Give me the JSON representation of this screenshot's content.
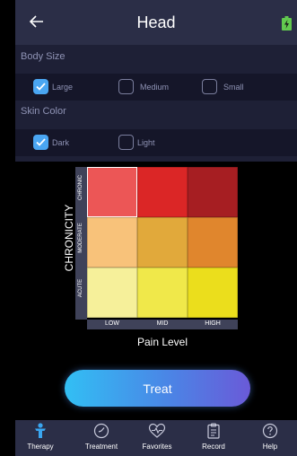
{
  "header": {
    "title": "Head",
    "back_icon": "arrow-left-icon",
    "battery_icon": "battery-icon"
  },
  "body_size": {
    "label": "Body Size",
    "options": [
      {
        "label": "Large",
        "checked": true
      },
      {
        "label": "Medium",
        "checked": false
      },
      {
        "label": "Small",
        "checked": false
      }
    ]
  },
  "skin_color": {
    "label": "Skin Color",
    "options": [
      {
        "label": "Dark",
        "checked": true
      },
      {
        "label": "Light",
        "checked": false
      }
    ]
  },
  "matrix": {
    "y_axis_title": "CHRONICITY",
    "x_axis_title": "Pain Level",
    "rows": [
      "CHRONIC",
      "MODERATE",
      "ACUTE"
    ],
    "cols": [
      "LOW",
      "MID",
      "HIGH"
    ],
    "selected": {
      "row": "CHRONIC",
      "col": "LOW"
    },
    "colors": [
      [
        "#ec5656",
        "#db2626",
        "#a61e22"
      ],
      [
        "#f8c27a",
        "#e1a93b",
        "#e0862d"
      ],
      [
        "#f6f09a",
        "#f0e84a",
        "#ebde1c"
      ]
    ]
  },
  "treat_button": {
    "label": "Treat"
  },
  "tabs": [
    {
      "label": "Therapy",
      "icon": "body-icon",
      "active": true
    },
    {
      "label": "Treatment",
      "icon": "clock-icon",
      "active": false
    },
    {
      "label": "Favorites",
      "icon": "heart-pulse-icon",
      "active": false
    },
    {
      "label": "Record",
      "icon": "clipboard-icon",
      "active": false
    },
    {
      "label": "Help",
      "icon": "help-icon",
      "active": false
    }
  ],
  "colors": {
    "accent": "#4aa6f2",
    "header_bg": "#2b2e47",
    "panel_bg": "#1e2036"
  }
}
